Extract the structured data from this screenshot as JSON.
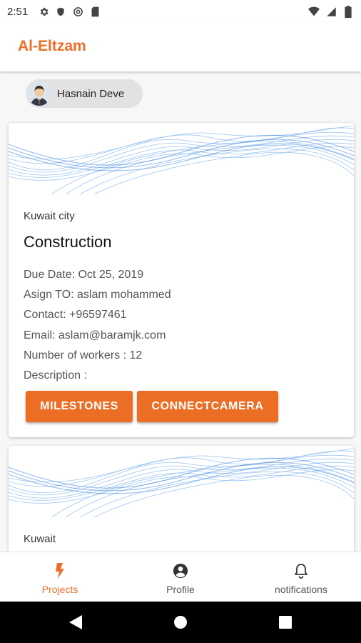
{
  "status_bar": {
    "time": "2:51",
    "left_icons": [
      "gear-icon",
      "shield-icon",
      "at-sign-icon",
      "sd-card-icon"
    ],
    "right_icons": [
      "wifi-icon",
      "signal-icon",
      "battery-icon"
    ]
  },
  "app": {
    "title": "Al-Eltzam",
    "accent_color": "#ec6d24"
  },
  "user_chip": {
    "name": "Hasnain Deve"
  },
  "projects": [
    {
      "location": "Kuwait city",
      "title": "Construction",
      "due_date": "Due Date: Oct 25, 2019",
      "assign_to": "Asign TO: aslam mohammed",
      "contact": "Contact: +96597461",
      "email": "Email: aslam@baramjk.com",
      "workers": "Number of workers : 12",
      "description": "Description :",
      "buttons": {
        "milestones": "MILESTONES",
        "camera": "CONNECTCAMERA"
      }
    },
    {
      "location": "Kuwait"
    }
  ],
  "bottom_nav": {
    "items": [
      {
        "label": "Projects",
        "icon": "bolt-icon",
        "active": true
      },
      {
        "label": "Profile",
        "icon": "account-circle-icon",
        "active": false
      },
      {
        "label": "notifications",
        "icon": "bell-icon",
        "active": false
      }
    ]
  },
  "system_nav": [
    "back-icon",
    "home-icon",
    "recents-icon"
  ]
}
